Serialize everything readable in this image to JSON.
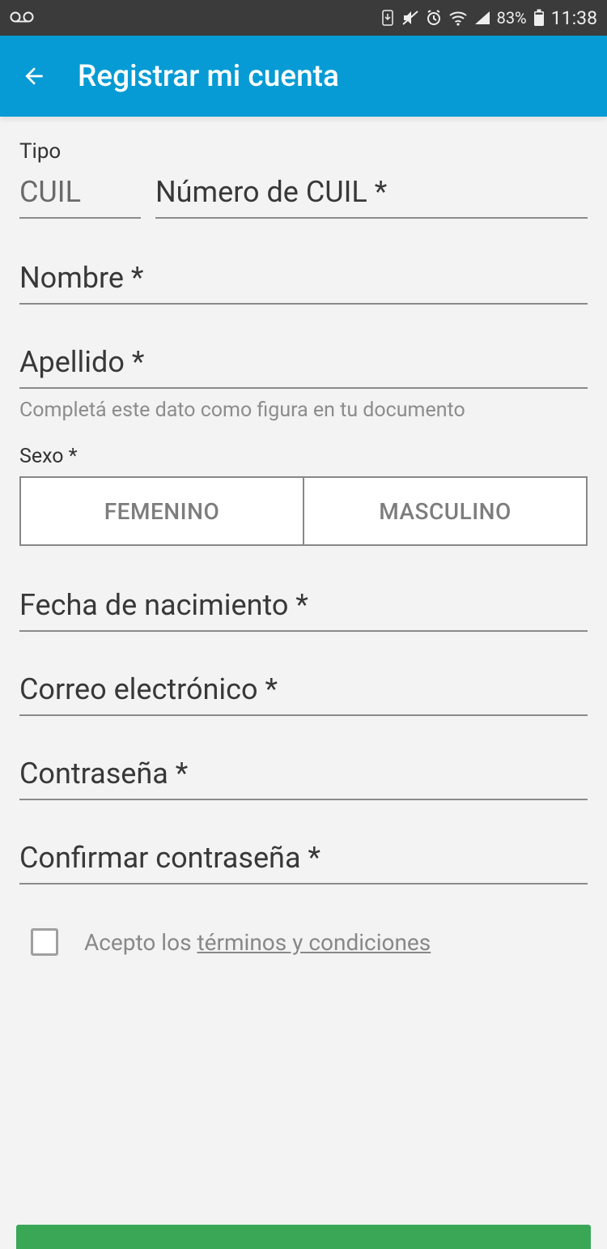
{
  "statusbar": {
    "battery_pct": "83%",
    "time": "11:38"
  },
  "appbar": {
    "title": "Registrar mi cuenta"
  },
  "form": {
    "tipo_label": "Tipo",
    "tipo_value": "CUIL",
    "cuil_placeholder": "Número de CUIL *",
    "nombre_placeholder": "Nombre *",
    "apellido_placeholder": "Apellido *",
    "apellido_helper": "Completá este dato como figura en tu documento",
    "sexo_label": "Sexo *",
    "sexo_options": {
      "fem": "FEMENINO",
      "masc": "MASCULINO"
    },
    "fecha_placeholder": "Fecha de nacimiento *",
    "correo_placeholder": "Correo electrónico *",
    "pass_placeholder": "Contraseña *",
    "pass2_placeholder": "Confirmar contraseña *",
    "terms_prefix": "Acepto los ",
    "terms_link": "términos y condiciones"
  }
}
